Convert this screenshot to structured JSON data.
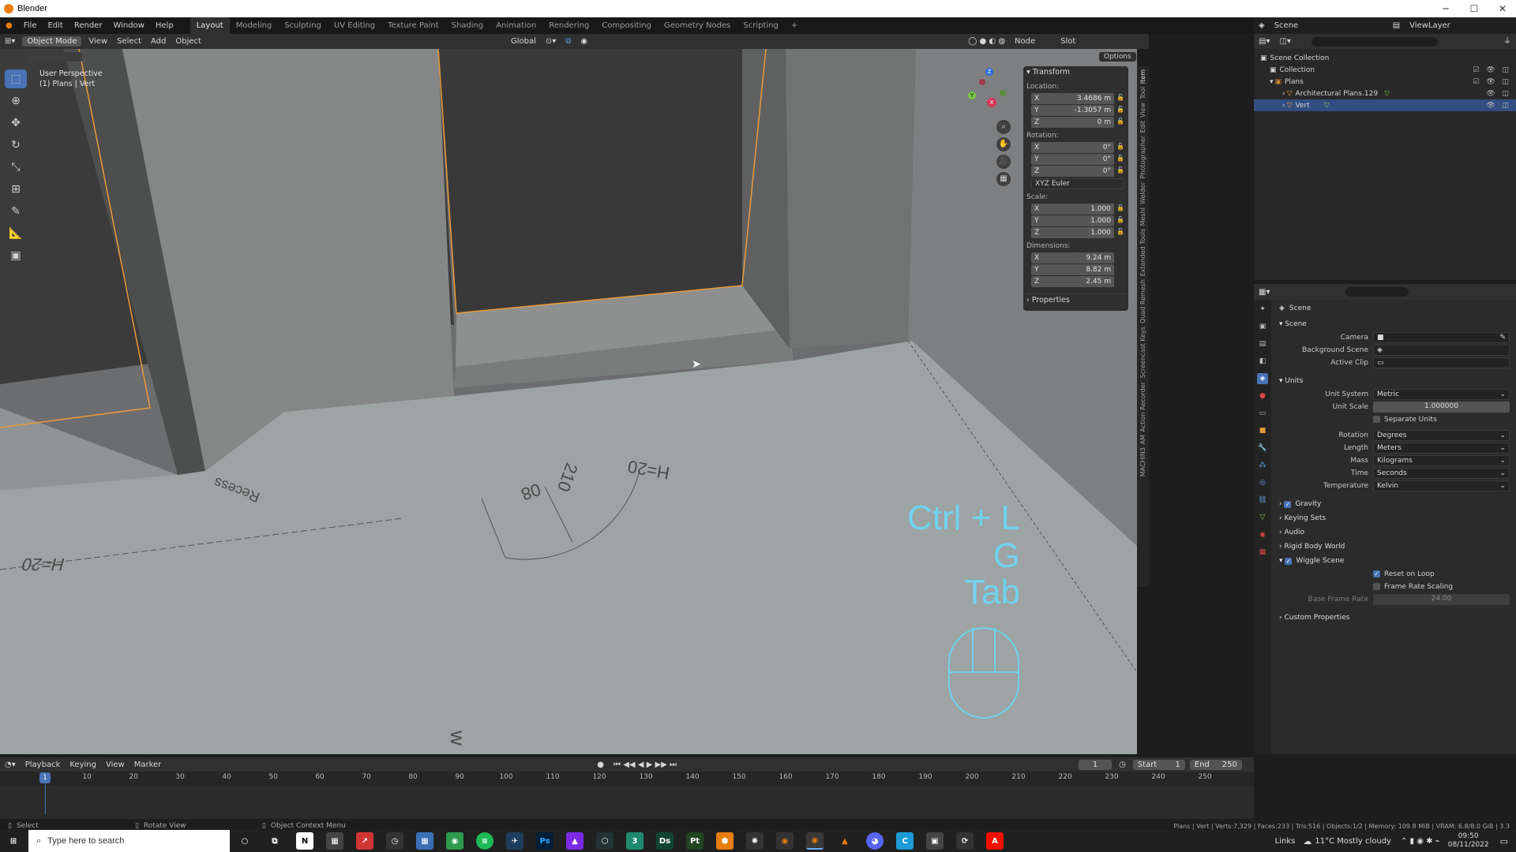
{
  "window": {
    "title": "Blender",
    "min": "─",
    "max": "☐",
    "close": "✕"
  },
  "menu": [
    "File",
    "Edit",
    "Render",
    "Window",
    "Help"
  ],
  "workspaces": [
    "Layout",
    "Modeling",
    "Sculpting",
    "UV Editing",
    "Texture Paint",
    "Shading",
    "Animation",
    "Rendering",
    "Compositing",
    "Geometry Nodes",
    "Scripting",
    "+"
  ],
  "scene_selector": "Scene",
  "viewlayer_selector": "ViewLayer",
  "viewport_header": {
    "mode": "Object Mode",
    "menus": [
      "View",
      "Select",
      "Add",
      "Object"
    ],
    "orientation": "Global",
    "options": "Options",
    "node_label": "Node",
    "slot": "Slot"
  },
  "viewport": {
    "perspective": "User Perspective",
    "object_label": "(1) Plans | Vert",
    "floor_annotations": [
      "H=20",
      "Recess",
      "08",
      "210",
      "H=20",
      "w"
    ],
    "key_overlay": [
      "Ctrl + L",
      "G",
      "Tab"
    ],
    "gizmo_axes": [
      "X",
      "Y",
      "Z"
    ]
  },
  "npanel": {
    "header": "Transform",
    "location_label": "Location:",
    "location": [
      {
        "axis": "X",
        "value": "3.4686 m"
      },
      {
        "axis": "Y",
        "value": "-1.3057 m"
      },
      {
        "axis": "Z",
        "value": "0 m"
      }
    ],
    "rotation_label": "Rotation:",
    "rotation": [
      {
        "axis": "X",
        "value": "0°"
      },
      {
        "axis": "Y",
        "value": "0°"
      },
      {
        "axis": "Z",
        "value": "0°"
      }
    ],
    "rotation_mode": "XYZ Euler",
    "scale_label": "Scale:",
    "scale": [
      {
        "axis": "X",
        "value": "1.000"
      },
      {
        "axis": "Y",
        "value": "1.000"
      },
      {
        "axis": "Z",
        "value": "1.000"
      }
    ],
    "dimensions_label": "Dimensions:",
    "dimensions": [
      {
        "axis": "X",
        "value": "9.24 m"
      },
      {
        "axis": "Y",
        "value": "8.82 m"
      },
      {
        "axis": "Z",
        "value": "2.45 m"
      }
    ],
    "properties": "Properties"
  },
  "side_tabs": [
    "Item",
    "Tool",
    "View",
    "Edit",
    "Photographer",
    "Welder",
    "MeshI",
    "Extended Tools",
    "Quad Remesh",
    "Screencast Keys",
    "Action Recorder",
    "AM",
    "MACHIN3"
  ],
  "outliner": {
    "rows": [
      {
        "label": "Scene Collection",
        "indent": 0,
        "selected": false
      },
      {
        "label": "Collection",
        "indent": 1,
        "selected": false
      },
      {
        "label": "Plans",
        "indent": 1,
        "selected": false
      },
      {
        "label": "Architectural Plans.129",
        "indent": 2,
        "selected": false
      },
      {
        "label": "Vert",
        "indent": 2,
        "selected": true
      }
    ]
  },
  "properties": {
    "breadcrumb": "Scene",
    "scene_section": "Scene",
    "camera_label": "Camera",
    "background_label": "Background Scene",
    "clip_label": "Active Clip",
    "units_section": "Units",
    "unit_system_label": "Unit System",
    "unit_system": "Metric",
    "unit_scale_label": "Unit Scale",
    "unit_scale": "1.000000",
    "separate_units": "Separate Units",
    "rotation_label": "Rotation",
    "rotation": "Degrees",
    "length_label": "Length",
    "length": "Meters",
    "mass_label": "Mass",
    "mass": "Kilograms",
    "time_label": "Time",
    "time": "Seconds",
    "temperature_label": "Temperature",
    "temperature": "Kelvin",
    "gravity": "Gravity",
    "keying_sets": "Keying Sets",
    "audio": "Audio",
    "rigid_body": "Rigid Body World",
    "wiggle": "Wiggle Scene",
    "reset_on_loop": "Reset on Loop",
    "frame_rate_scaling": "Frame Rate Scaling",
    "base_frame_rate_label": "Base Frame Rate",
    "base_frame_rate": "24.00",
    "custom_props": "Custom Properties"
  },
  "timeline": {
    "menus": [
      "Playback",
      "Keying",
      "View",
      "Marker"
    ],
    "current_frame": "1",
    "start_label": "Start",
    "start": "1",
    "end_label": "End",
    "end": "250",
    "ticks": [
      "1",
      "10",
      "20",
      "30",
      "40",
      "50",
      "60",
      "70",
      "80",
      "90",
      "100",
      "110",
      "120",
      "130",
      "140",
      "150",
      "160",
      "170",
      "180",
      "190",
      "200",
      "210",
      "220",
      "230",
      "240",
      "250"
    ]
  },
  "statusbar": {
    "select": "Select",
    "rotate": "Rotate View",
    "context": "Object Context Menu",
    "stats": "Plans | Vert | Verts:7,329 | Faces:233 | Tris:516 | Objects:1/2 | Memory: 109.8 MiB | VRAM: 6.8/8.0 GiB | 3.3"
  },
  "taskbar": {
    "search_placeholder": "Type here to search",
    "links": "Links",
    "weather": "11°C  Mostly cloudy",
    "time": "09:50",
    "date": "08/11/2022"
  }
}
